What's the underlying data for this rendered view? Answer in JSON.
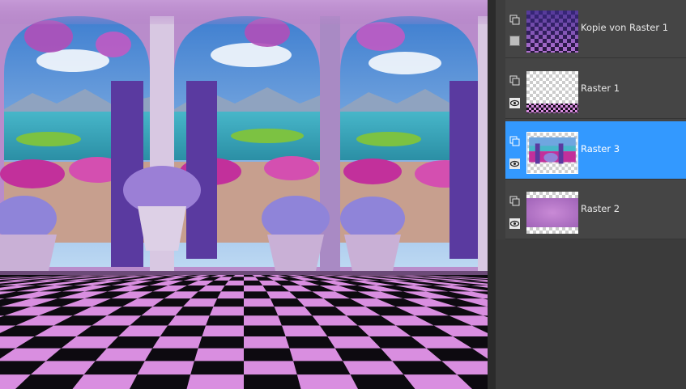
{
  "canvas": {
    "description_icon": "collage-image"
  },
  "layers": [
    {
      "name": "Kopie von Raster 1",
      "selected": false,
      "thumbnail": "checker-purple",
      "visibility": "hidden-box"
    },
    {
      "name": "Raster 1",
      "selected": false,
      "thumbnail": "transparent-with-floor",
      "visibility": "eye-icon"
    },
    {
      "name": "Raster 3",
      "selected": true,
      "thumbnail": "garden-scene",
      "visibility": "eye-icon"
    },
    {
      "name": "Raster 2",
      "selected": false,
      "thumbnail": "purple-texture",
      "visibility": "eye-icon"
    }
  ],
  "colors": {
    "selected": "#3399ff",
    "panel": "#454545",
    "checker_pink": "#d98ee0",
    "checker_dark": "#0d0a10"
  }
}
